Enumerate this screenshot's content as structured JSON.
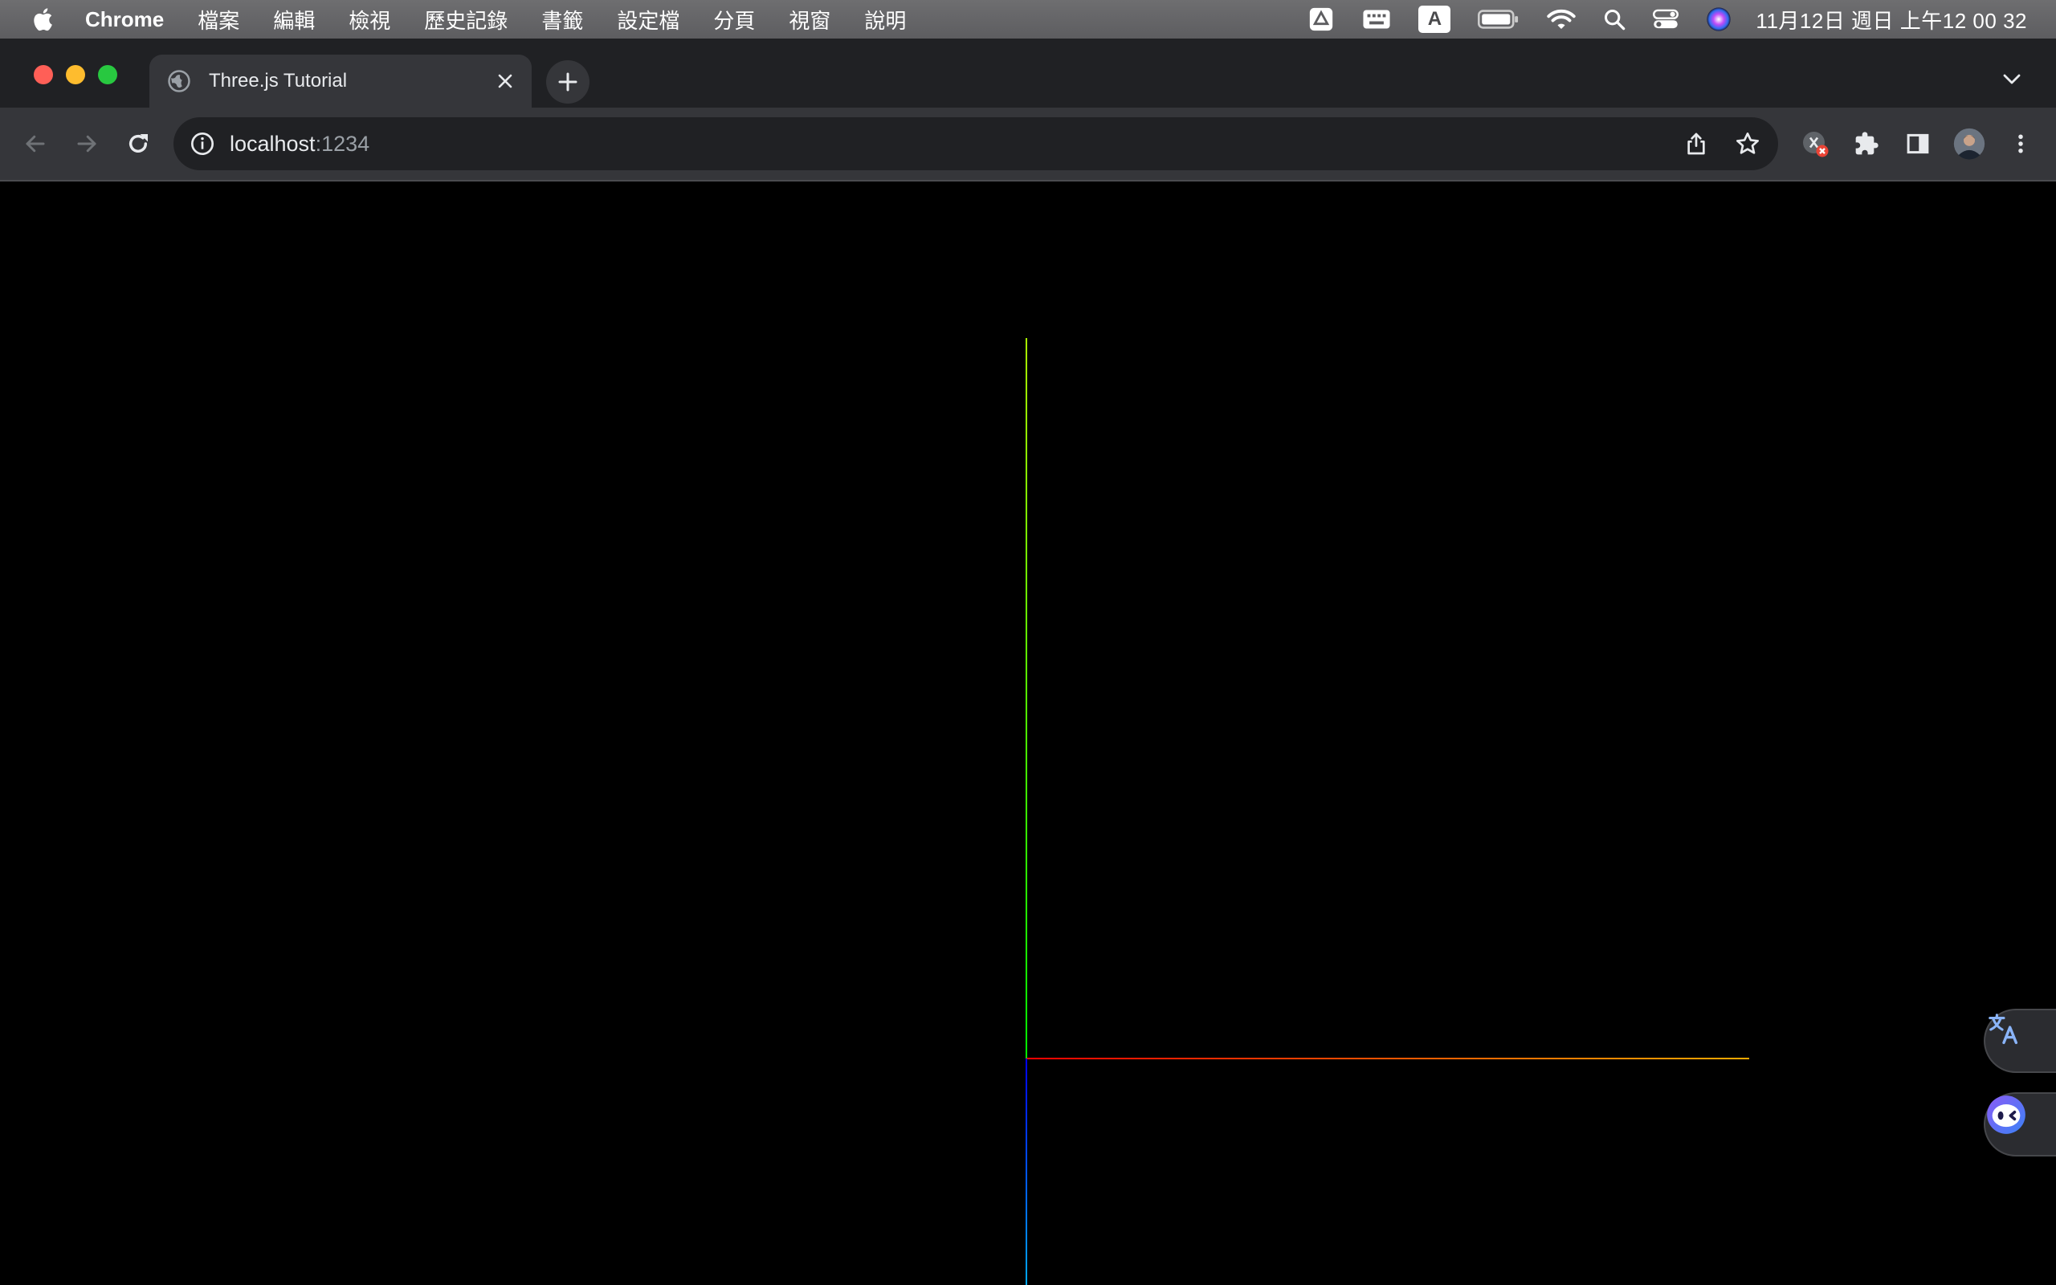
{
  "menubar": {
    "app_name": "Chrome",
    "items": [
      "檔案",
      "編輯",
      "檢視",
      "歷史記錄",
      "書籤",
      "設定檔",
      "分頁",
      "視窗",
      "說明"
    ],
    "input_indicator": "A",
    "clock": "11月12日 週日 上午12 00 32"
  },
  "tab": {
    "title": "Three.js Tutorial"
  },
  "omnibox": {
    "host": "localhost",
    "port": ":1234"
  },
  "scene": {
    "background": "#000000",
    "axes": [
      {
        "name": "x-axis",
        "color_start": "#ff0000",
        "color_end": "#ffaa00"
      },
      {
        "name": "y-axis",
        "color_start": "#00ff00",
        "color_end": "#aaff00"
      },
      {
        "name": "z-axis",
        "color_start": "#0000ff",
        "color_end": "#00aaff"
      }
    ]
  },
  "colors": {
    "menubar": "#646466",
    "tabstrip": "#202124",
    "toolbar": "#35363a",
    "accent_blue": "#8ab4f8"
  }
}
